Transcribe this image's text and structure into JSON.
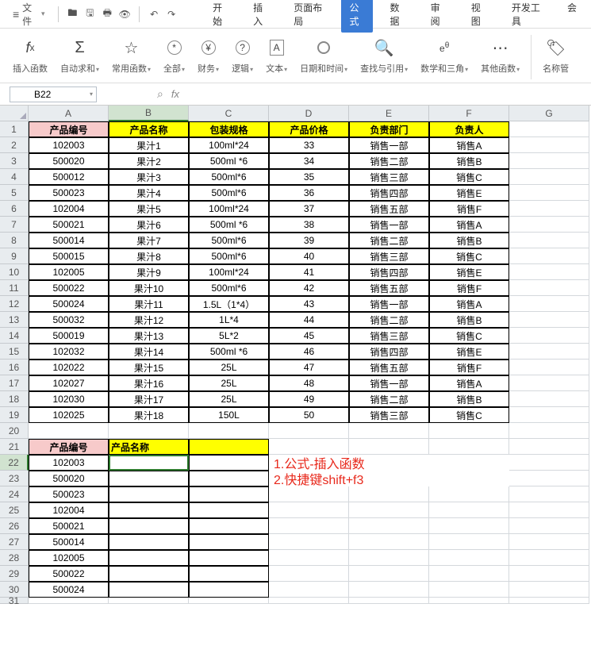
{
  "menu": {
    "file_label": "文件",
    "toolbar_icons": [
      "folder-open-icon",
      "save-icon",
      "print-icon",
      "print-preview-icon",
      "undo-icon",
      "redo-icon"
    ],
    "tabs": [
      {
        "label": "开始",
        "active": false
      },
      {
        "label": "插入",
        "active": false
      },
      {
        "label": "页面布局",
        "active": false
      },
      {
        "label": "公式",
        "active": true
      },
      {
        "label": "数据",
        "active": false
      },
      {
        "label": "审阅",
        "active": false
      },
      {
        "label": "视图",
        "active": false
      },
      {
        "label": "开发工具",
        "active": false
      },
      {
        "label": "会",
        "active": false
      }
    ]
  },
  "ribbon": [
    {
      "icon": "fx",
      "label": "插入函数",
      "dd": false
    },
    {
      "icon": "Σ",
      "label": "自动求和",
      "dd": true
    },
    {
      "icon": "☆",
      "label": "常用函数",
      "dd": true
    },
    {
      "icon": "⊛",
      "label": "全部",
      "dd": true
    },
    {
      "icon": "¥",
      "label": "财务",
      "dd": true
    },
    {
      "icon": "?",
      "label": "逻辑",
      "dd": true
    },
    {
      "icon": "A",
      "label": "文本",
      "dd": true
    },
    {
      "icon": "◎",
      "label": "日期和时间",
      "dd": true
    },
    {
      "icon": "🔍",
      "label": "查找与引用",
      "dd": true
    },
    {
      "icon": "e^",
      "label": "数学和三角",
      "dd": true
    },
    {
      "icon": "⋯",
      "label": "其他函数",
      "dd": true
    },
    {
      "icon": "🏷",
      "label": "名称管",
      "dd": false
    }
  ],
  "namebox": {
    "value": "B22"
  },
  "columns": [
    "",
    "A",
    "B",
    "C",
    "D",
    "E",
    "F",
    "G"
  ],
  "selected_col_idx": 2,
  "selected_row": 22,
  "headers1": [
    "产品编号",
    "产品名称",
    "包装规格",
    "产品价格",
    "负责部门",
    "负责人"
  ],
  "table": [
    [
      "102003",
      "果汁1",
      "100ml*24",
      "33",
      "销售一部",
      "销售A"
    ],
    [
      "500020",
      "果汁2",
      "500ml *6",
      "34",
      "销售二部",
      "销售B"
    ],
    [
      "500012",
      "果汁3",
      "500ml*6",
      "35",
      "销售三部",
      "销售C"
    ],
    [
      "500023",
      "果汁4",
      "500ml*6",
      "36",
      "销售四部",
      "销售E"
    ],
    [
      "102004",
      "果汁5",
      "100ml*24",
      "37",
      "销售五部",
      "销售F"
    ],
    [
      "500021",
      "果汁6",
      "500ml *6",
      "38",
      "销售一部",
      "销售A"
    ],
    [
      "500014",
      "果汁7",
      "500ml*6",
      "39",
      "销售二部",
      "销售B"
    ],
    [
      "500015",
      "果汁8",
      "500ml*6",
      "40",
      "销售三部",
      "销售C"
    ],
    [
      "102005",
      "果汁9",
      "100ml*24",
      "41",
      "销售四部",
      "销售E"
    ],
    [
      "500022",
      "果汁10",
      "500ml*6",
      "42",
      "销售五部",
      "销售F"
    ],
    [
      "500024",
      "果汁11",
      "1.5L（1*4）",
      "43",
      "销售一部",
      "销售A"
    ],
    [
      "500032",
      "果汁12",
      "1L*4",
      "44",
      "销售二部",
      "销售B"
    ],
    [
      "500019",
      "果汁13",
      "5L*2",
      "45",
      "销售三部",
      "销售C"
    ],
    [
      "102032",
      "果汁14",
      "500ml *6",
      "46",
      "销售四部",
      "销售E"
    ],
    [
      "102022",
      "果汁15",
      "25L",
      "47",
      "销售五部",
      "销售F"
    ],
    [
      "102027",
      "果汁16",
      "25L",
      "48",
      "销售一部",
      "销售A"
    ],
    [
      "102030",
      "果汁17",
      "25L",
      "49",
      "销售二部",
      "销售B"
    ],
    [
      "102025",
      "果汁18",
      "150L",
      "50",
      "销售三部",
      "销售C"
    ]
  ],
  "headers2": [
    "产品编号",
    "产品名称",
    ""
  ],
  "table2": [
    "102003",
    "500020",
    "500023",
    "102004",
    "500021",
    "500014",
    "102005",
    "500022",
    "500024"
  ],
  "notes": [
    "1.公式-插入函数",
    "2.快捷键shift+f3"
  ],
  "last_row_head": "31"
}
